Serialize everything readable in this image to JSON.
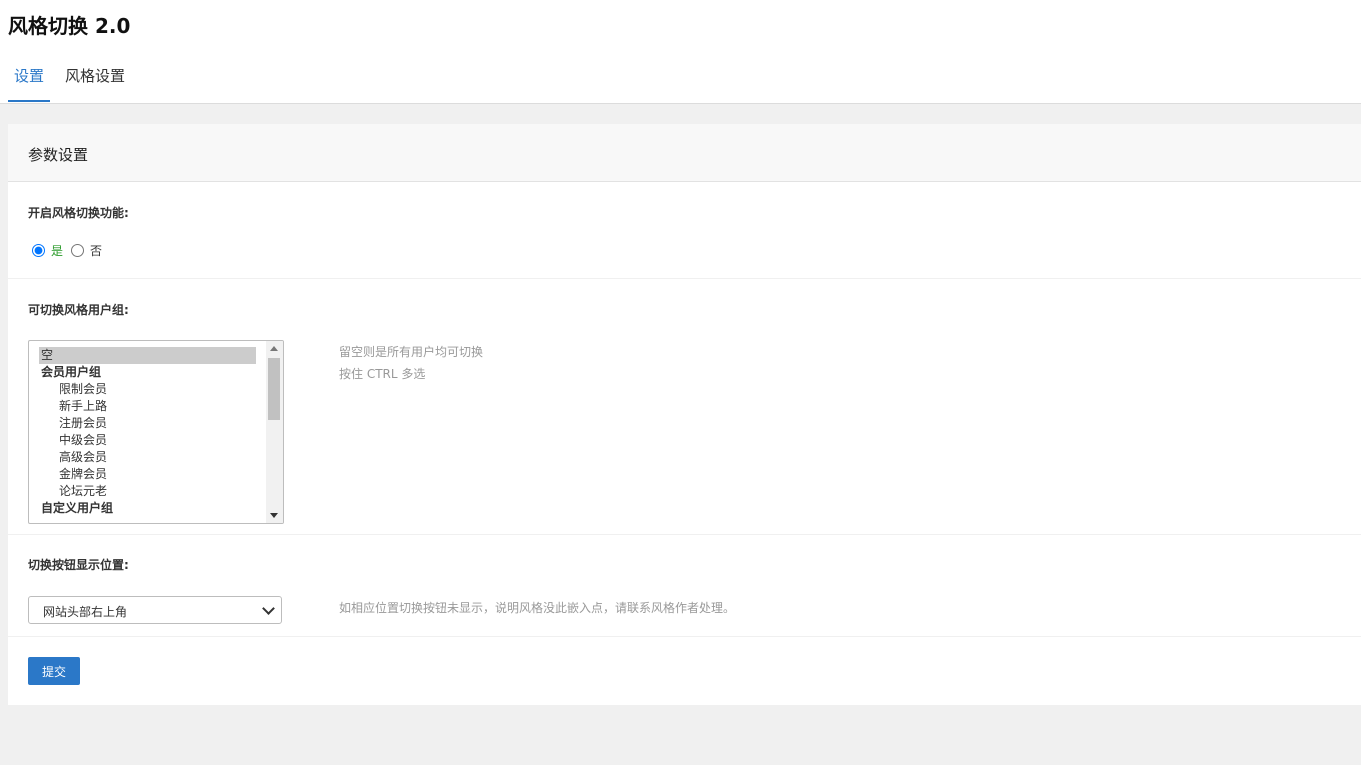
{
  "app": {
    "title": "风格切换 2.0"
  },
  "tabs": [
    {
      "label": "设置",
      "active": true
    },
    {
      "label": "风格设置",
      "active": false
    }
  ],
  "panel": {
    "title": "参数设置",
    "enable": {
      "label": "开启风格切换功能:",
      "options": [
        "是",
        "否"
      ],
      "selected": "是"
    },
    "groups": {
      "label": "可切换风格用户组:",
      "items": [
        {
          "text": "空",
          "type": "empty",
          "selected": true
        },
        {
          "text": "会员用户组",
          "type": "group"
        },
        {
          "text": "限制会员",
          "type": "child"
        },
        {
          "text": "新手上路",
          "type": "child"
        },
        {
          "text": "注册会员",
          "type": "child"
        },
        {
          "text": "中级会员",
          "type": "child"
        },
        {
          "text": "高级会员",
          "type": "child"
        },
        {
          "text": "金牌会员",
          "type": "child"
        },
        {
          "text": "论坛元老",
          "type": "child"
        },
        {
          "text": "自定义用户组",
          "type": "group"
        }
      ],
      "hint1": "留空则是所有用户均可切换",
      "hint2": "按住 CTRL 多选"
    },
    "position": {
      "label": "切换按钮显示位置:",
      "value": "网站头部右上角",
      "hint": "如相应位置切换按钮未显示，说明风格没此嵌入点，请联系风格作者处理。"
    },
    "submit_label": "提交"
  },
  "colors": {
    "accent": "#2b78c8",
    "yes": "#2a9a2a"
  }
}
